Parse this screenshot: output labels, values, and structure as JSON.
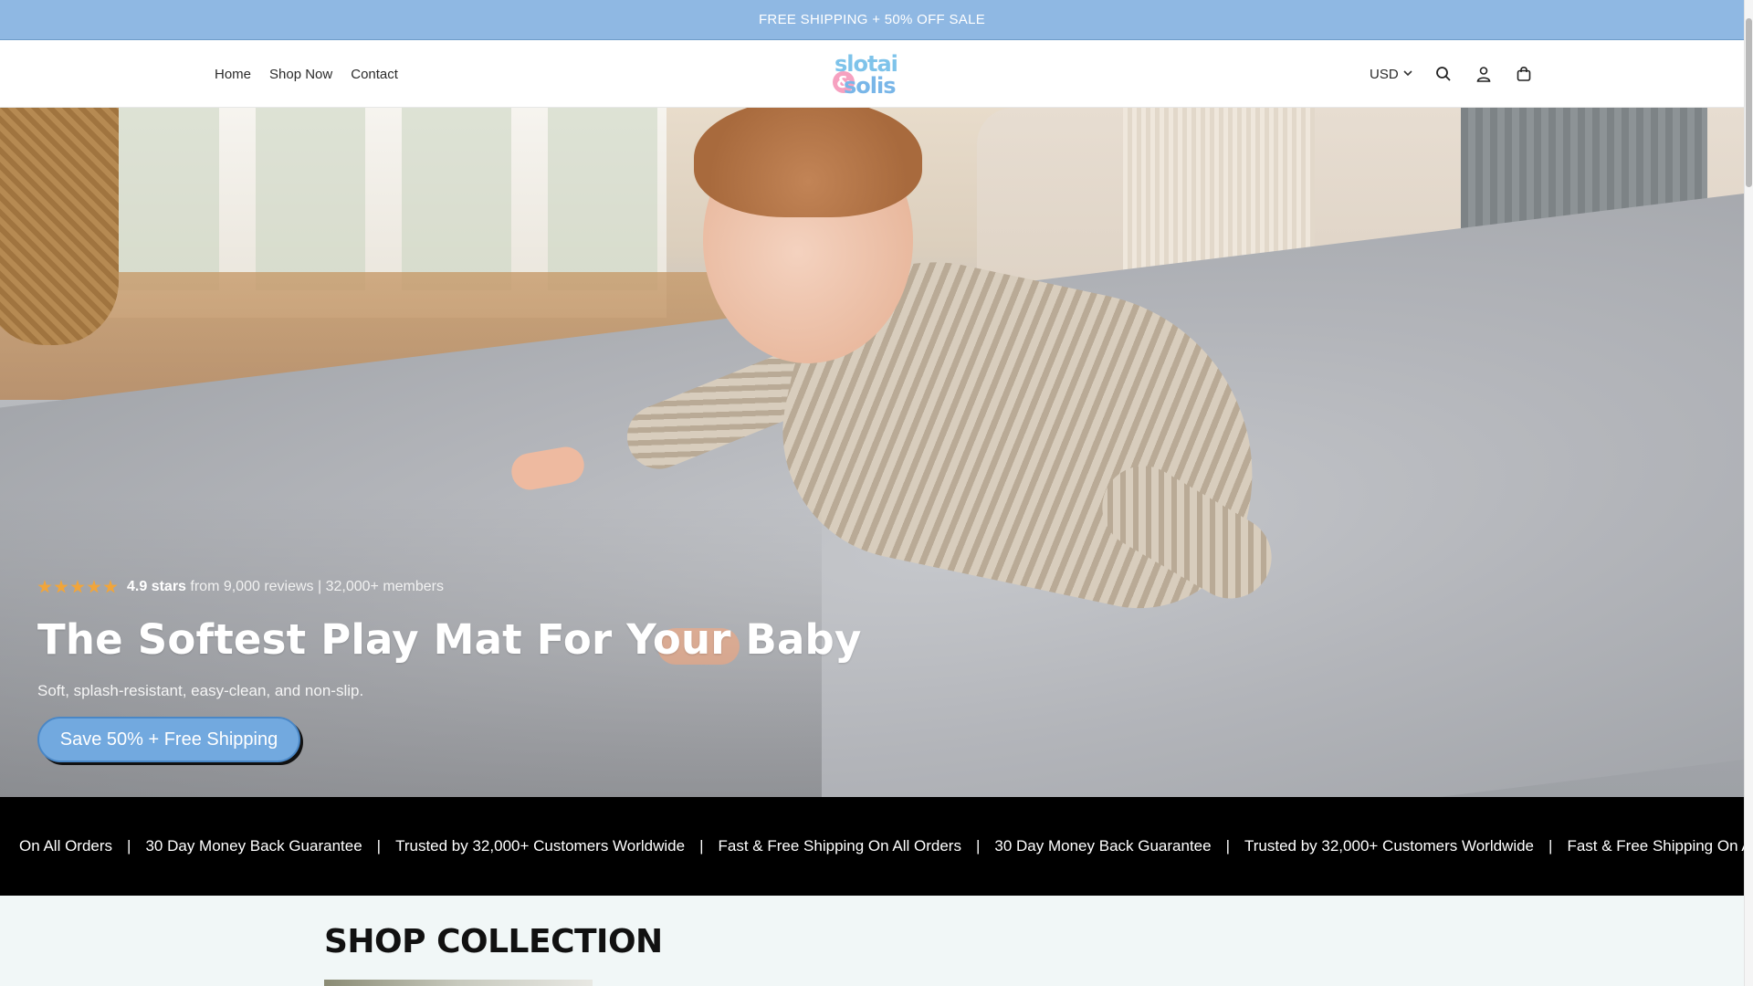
{
  "announcement": {
    "text": "FREE SHIPPING + 50% OFF SALE"
  },
  "header": {
    "nav": [
      {
        "label": "Home"
      },
      {
        "label": "Shop Now"
      },
      {
        "label": "Contact"
      }
    ],
    "logo": {
      "line1": "slotai",
      "amp": "&",
      "line2": "solis"
    },
    "currency": {
      "label": "USD"
    },
    "icons": [
      "search-icon",
      "account-icon",
      "cart-icon"
    ]
  },
  "hero": {
    "rating": {
      "stars": 5,
      "score": "4.9 stars",
      "details": "from 9,000 reviews | 32,000+ members"
    },
    "headline": "The Softest Play Mat For Your Baby",
    "subtext": "Soft, splash-resistant, easy-clean, and non-slip.",
    "cta_label": "Save 50% + Free Shipping"
  },
  "marquee": {
    "items": [
      "On All Orders",
      "30 Day Money Back Guarantee",
      "Trusted by 32,000+ Customers Worldwide",
      "Fast & Free Shipping On All Orders",
      "30 Day Money Back Guarantee",
      "Trusted by 32,000+ Customers Worldwide",
      "Fast & Free Shipping On All Or"
    ],
    "separator": "|"
  },
  "collection": {
    "title": "SHOP COLLECTION"
  },
  "colors": {
    "announcement_bg": "#8fb8e3",
    "cta_bg": "#72a9df",
    "star": "#f1a53a",
    "marquee_bg": "#000000",
    "collection_bg": "#f1f7f7"
  }
}
